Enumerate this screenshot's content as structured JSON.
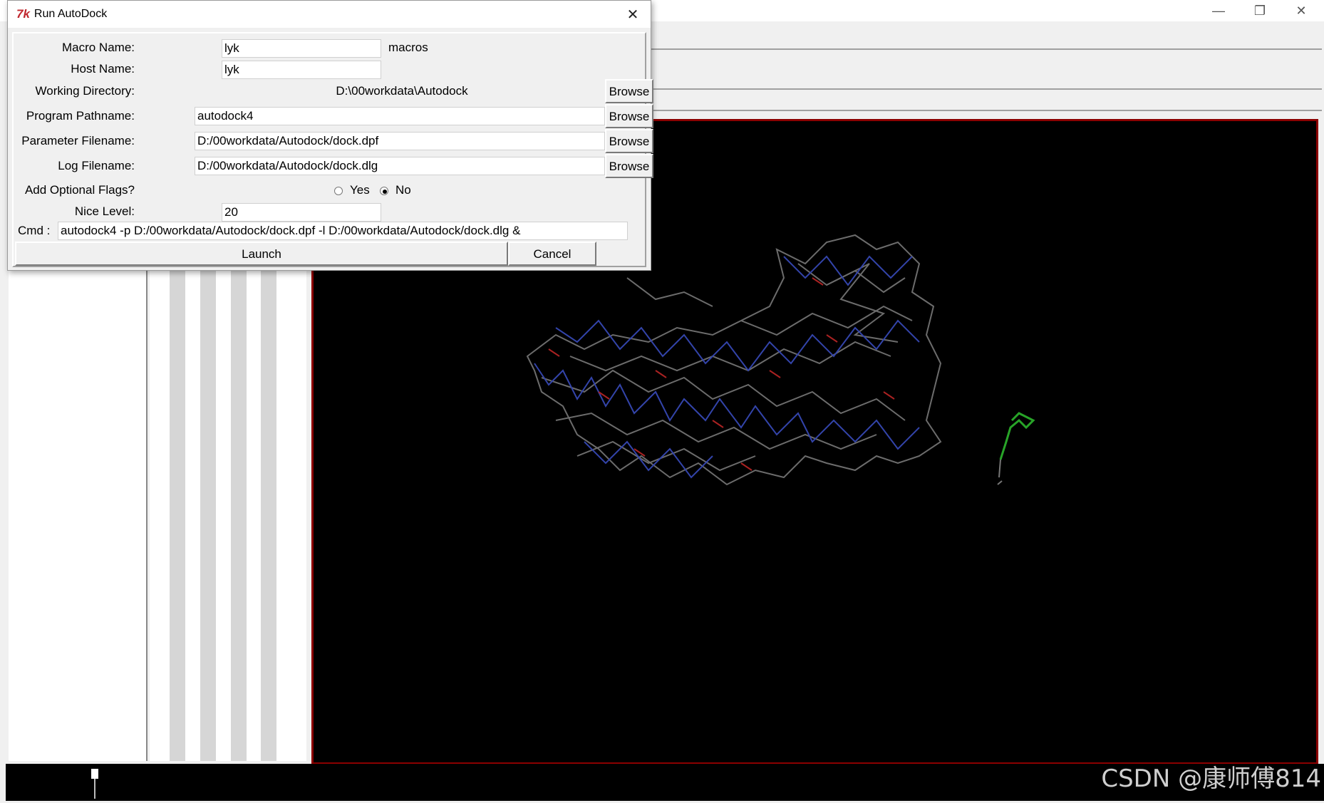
{
  "dialog": {
    "title": "Run AutoDock",
    "tk_icon": "7k",
    "close_icon": "✕",
    "fields": {
      "macro_name": {
        "label": "Macro Name:",
        "value": "lyk",
        "suffix": "macros"
      },
      "host_name": {
        "label": "Host Name:",
        "value": "lyk"
      },
      "working_directory": {
        "label": "Working Directory:",
        "value": "D:\\00workdata\\Autodock",
        "button": "Browse"
      },
      "program_pathname": {
        "label": "Program Pathname:",
        "value": "autodock4",
        "button": "Browse"
      },
      "parameter_filename": {
        "label": "Parameter Filename:",
        "value": "D:/00workdata/Autodock/dock.dpf",
        "button": "Browse"
      },
      "log_filename": {
        "label": "Log Filename:",
        "value": "D:/00workdata/Autodock/dock.dlg",
        "button": "Browse"
      },
      "optional_flags": {
        "label": "Add Optional Flags?",
        "options": [
          "Yes",
          "No"
        ],
        "selected": "No"
      },
      "nice_level": {
        "label": "Nice Level:",
        "value": "20"
      },
      "cmd": {
        "label": "Cmd :",
        "value": "autodock4  -p D:/00workdata/Autodock/dock.dpf -l D:/00workdata/Autodock/dock.dlg &"
      }
    },
    "buttons": {
      "launch": "Launch",
      "cancel": "Cancel"
    }
  },
  "app_window": {
    "minimize_icon": "—",
    "restore_icon": "❐",
    "close_icon": "✕",
    "viewer_border_color": "#8b0000",
    "viewer_background": "#000000"
  },
  "watermark": "CSDN @康师傅814"
}
